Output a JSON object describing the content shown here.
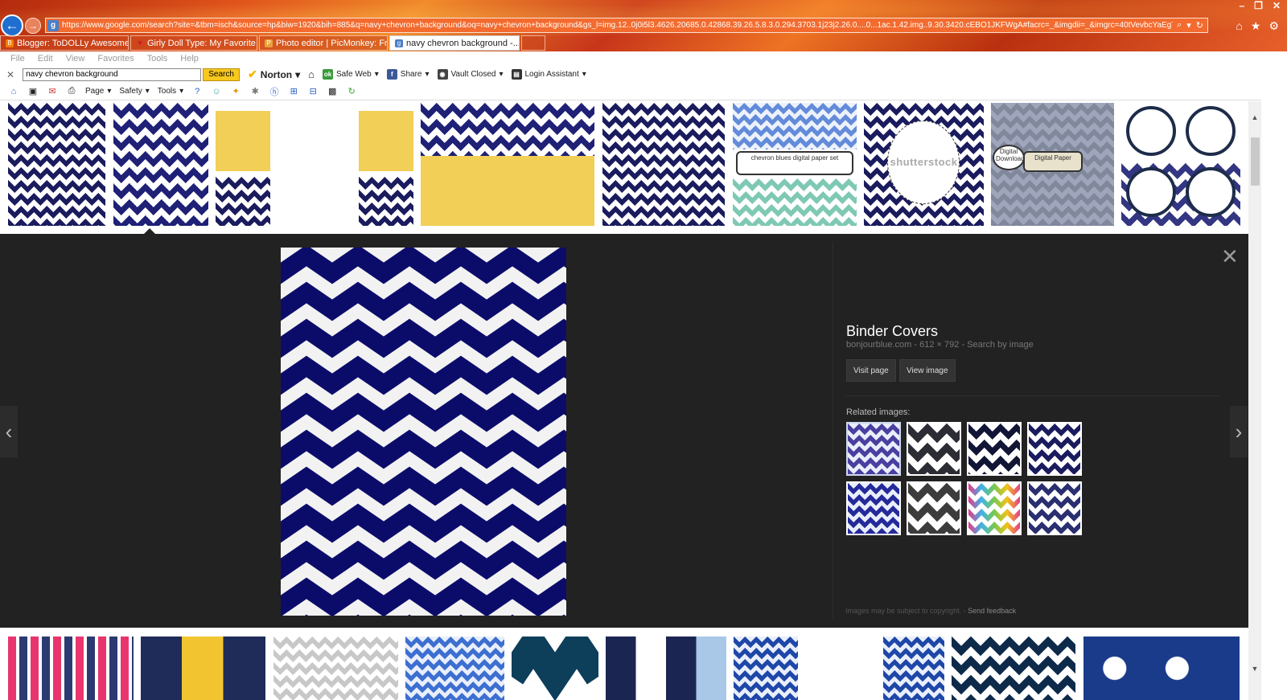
{
  "browser": {
    "address_url": "https://www.google.com/search?site=&tbm=isch&source=hp&biw=1920&bih=885&q=navy+chevron+background&oq=navy+chevron+background&gs_l=img.12..0j0i5l3.4626.20685.0.42868.39.26.5.8.3.0.294.3703.1j23j2.26.0....0...1ac.1.42.img..9.30.3420.cEBO1JKFWgA#facrc=_&imgdii=_&imgrc=40tVevbcYaEgTM%253A",
    "address_icon": "g",
    "window_controls": [
      "–",
      "❐",
      "✕"
    ],
    "right_icons": [
      "home-icon",
      "star-icon",
      "gear-icon"
    ],
    "tabs": [
      {
        "label": "Blogger: ToDOLLy Awesome - ...",
        "icon": "blogger-icon",
        "color": "#f57d00",
        "active": false
      },
      {
        "label": "Girly Doll Type: My Favorite A...",
        "icon": "heart-icon",
        "color": "#d21f2b",
        "active": false
      },
      {
        "label": "Photo editor | PicMonkey: Free...",
        "icon": "picmonkey-icon",
        "color": "#e8a23a",
        "active": false
      },
      {
        "label": "navy chevron background -...",
        "icon": "google-icon",
        "color": "#4a7ec8",
        "active": true
      }
    ]
  },
  "menu": [
    "File",
    "Edit",
    "View",
    "Favorites",
    "Tools",
    "Help"
  ],
  "norton_toolbar": {
    "search_value": "navy chevron background",
    "search_button": "Search",
    "norton_label": "Norton",
    "safe_web": "Safe Web",
    "share": "Share",
    "vault": "Vault Closed",
    "login": "Login Assistant"
  },
  "command_bar": {
    "page": "Page",
    "safety": "Safety",
    "tools": "Tools"
  },
  "viewer": {
    "title": "Binder Covers",
    "source": "bonjourblue.com",
    "dimensions": "612 × 792",
    "search_by_image": "Search by image",
    "visit_page": "Visit page",
    "view_image": "View image",
    "related_label": "Related images:",
    "copyright_text": "Images may be subject to copyright.",
    "send_feedback": "Send feedback"
  },
  "thumb_watermarks": {
    "shutterstock": "shutterstock",
    "chevron_blues": "chevron blues digital paper set",
    "digital_download": "Digital Download",
    "digital_paper": "Digital Paper"
  },
  "colors": {
    "navy": "#1b1c5e",
    "viewer_bg": "#222222",
    "search_button": "#f7c81e"
  }
}
